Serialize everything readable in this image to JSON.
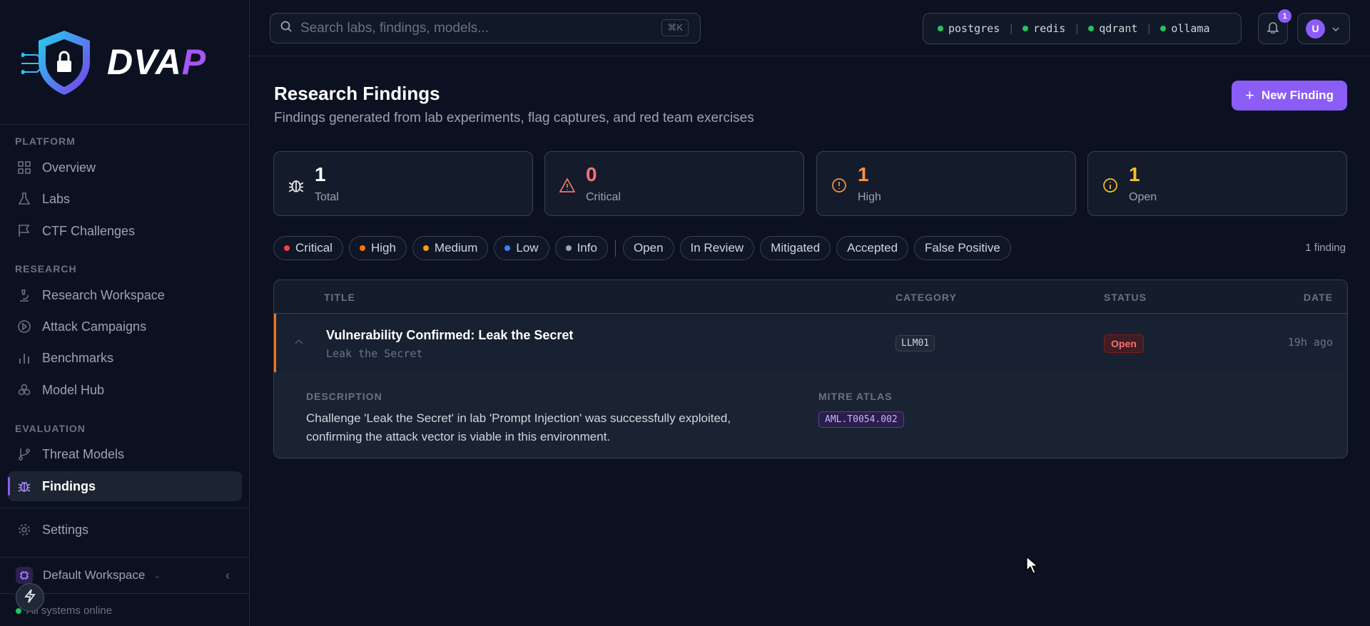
{
  "logo": {
    "text_main": "DVA",
    "text_accent": "P"
  },
  "sidebar": {
    "sections": [
      {
        "title": "PLATFORM"
      },
      {
        "title": "RESEARCH"
      },
      {
        "title": "EVALUATION"
      }
    ],
    "items": [
      {
        "label": "Overview",
        "icon": "grid-icon"
      },
      {
        "label": "Labs",
        "icon": "flask-icon"
      },
      {
        "label": "CTF Challenges",
        "icon": "flag-icon"
      },
      {
        "label": "Research Workspace",
        "icon": "microscope-icon"
      },
      {
        "label": "Attack Campaigns",
        "icon": "play-circle-icon"
      },
      {
        "label": "Benchmarks",
        "icon": "bar-chart-icon"
      },
      {
        "label": "Model Hub",
        "icon": "cubes-icon"
      },
      {
        "label": "Threat Models",
        "icon": "git-branch-icon"
      },
      {
        "label": "Findings",
        "icon": "bug-icon",
        "active": true
      },
      {
        "label": "Settings",
        "icon": "gear-icon"
      }
    ],
    "workspace": "Default Workspace",
    "system_status": "All systems online"
  },
  "search": {
    "placeholder": "Search labs, findings, models...",
    "shortcut": "⌘K"
  },
  "services": [
    "postgres",
    "redis",
    "qdrant",
    "ollama"
  ],
  "notifications": {
    "count": "1"
  },
  "user": {
    "initial": "U"
  },
  "page": {
    "title": "Research Findings",
    "subtitle": "Findings generated from lab experiments, flag captures, and red team exercises",
    "new_button": "New Finding"
  },
  "stats": [
    {
      "value": "1",
      "label": "Total",
      "color": "#ffffff",
      "icon": "bug-icon"
    },
    {
      "value": "0",
      "label": "Critical",
      "color": "#f87171",
      "icon": "warning-triangle-icon"
    },
    {
      "value": "1",
      "label": "High",
      "color": "#fb923c",
      "icon": "alert-circle-icon"
    },
    {
      "value": "1",
      "label": "Open",
      "color": "#fbbf24",
      "icon": "info-circle-icon"
    }
  ],
  "severity_filters": [
    {
      "label": "Critical",
      "color": "#ef4444"
    },
    {
      "label": "High",
      "color": "#f97316"
    },
    {
      "label": "Medium",
      "color": "#f59e0b"
    },
    {
      "label": "Low",
      "color": "#3b82f6"
    },
    {
      "label": "Info",
      "color": "#9ca3af"
    }
  ],
  "status_filters": [
    "Open",
    "In Review",
    "Mitigated",
    "Accepted",
    "False Positive"
  ],
  "finding_count": "1 finding",
  "table": {
    "headers": {
      "title": "TITLE",
      "category": "CATEGORY",
      "status": "STATUS",
      "date": "DATE"
    },
    "rows": [
      {
        "title": "Vulnerability Confirmed: Leak the Secret",
        "subtitle": "Leak the Secret",
        "category": "LLM01",
        "status": "Open",
        "date": "19h ago",
        "description_label": "DESCRIPTION",
        "description": "Challenge 'Leak the Secret' in lab 'Prompt Injection' was successfully exploited, confirming the attack vector is viable in this environment.",
        "atlas_label": "MITRE ATLAS",
        "atlas_id": "AML.T0054.002"
      }
    ]
  }
}
